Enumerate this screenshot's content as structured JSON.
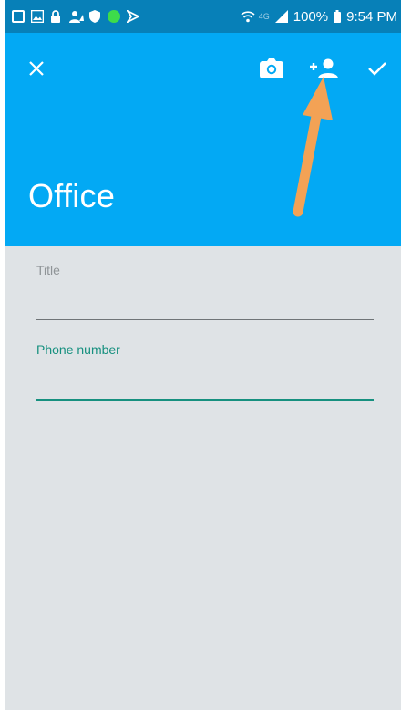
{
  "status_bar": {
    "battery": "100%",
    "time": "9:54 PM",
    "network": "4G",
    "left_icons": [
      "checkbox-notification-icon",
      "gallery-icon",
      "lock-icon",
      "person-alert-icon",
      "shield-icon",
      "green-dot-icon",
      "flag-icon"
    ]
  },
  "toolbar": {
    "close_icon": "close-icon",
    "camera_icon": "camera-icon",
    "add_contact_icon": "add-person-icon",
    "save_icon": "check-icon"
  },
  "header": {
    "title": "Office",
    "color": "#03a9f4"
  },
  "form": {
    "title_field": {
      "label": "Title",
      "value": ""
    },
    "phone_field": {
      "label": "Phone number",
      "value": "",
      "accent": "#16907f"
    }
  },
  "annotation": {
    "arrow_color": "#f3a255",
    "points_to": "add-contact-button"
  }
}
